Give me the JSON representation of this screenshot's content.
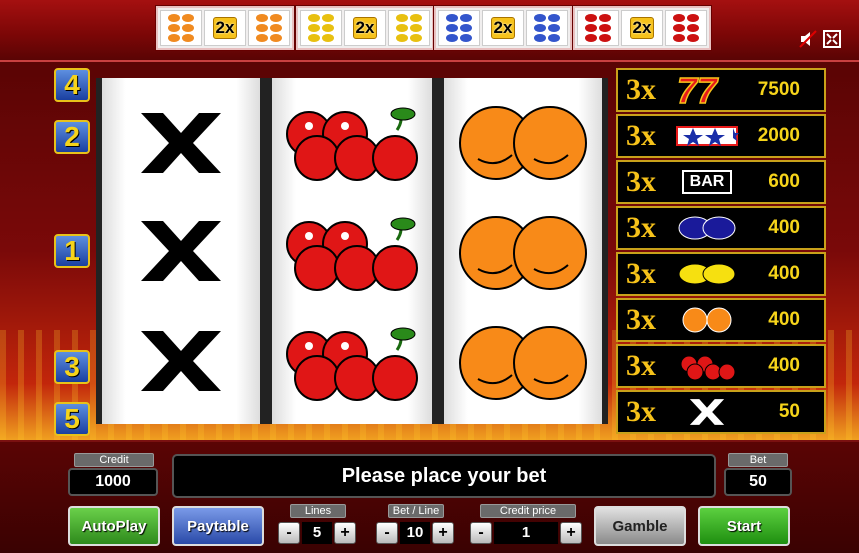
{
  "bonus_multipliers": [
    {
      "label": "2x",
      "fruit_color": "#f08a20"
    },
    {
      "label": "2x",
      "fruit_color": "#e8c010"
    },
    {
      "label": "2x",
      "fruit_color": "#3355cc"
    },
    {
      "label": "2x",
      "fruit_color": "#cc1111"
    }
  ],
  "system_icons": [
    "sound-off-icon",
    "fullscreen-icon"
  ],
  "lines_badges": [
    "4",
    "2",
    "1",
    "3",
    "5"
  ],
  "reels": [
    {
      "symbols": [
        "x",
        "x",
        "x"
      ]
    },
    {
      "symbols": [
        "cherries",
        "cherries",
        "cherries"
      ]
    },
    {
      "symbols": [
        "oranges",
        "oranges",
        "oranges"
      ]
    }
  ],
  "paytable": [
    {
      "count": "3x",
      "symbol": "seven",
      "value": "7500"
    },
    {
      "count": "3x",
      "symbol": "stars",
      "value": "2000"
    },
    {
      "count": "3x",
      "symbol": "bar",
      "value": "600",
      "symbol_text": "BAR"
    },
    {
      "count": "3x",
      "symbol": "plums",
      "value": "400"
    },
    {
      "count": "3x",
      "symbol": "lemons",
      "value": "400"
    },
    {
      "count": "3x",
      "symbol": "oranges",
      "value": "400"
    },
    {
      "count": "3x",
      "symbol": "cherries",
      "value": "400"
    },
    {
      "count": "3x",
      "symbol": "x",
      "value": "50"
    }
  ],
  "credit": {
    "label": "Credit",
    "value": "1000"
  },
  "bet": {
    "label": "Bet",
    "value": "50"
  },
  "message": "Please place your bet",
  "buttons": {
    "autoplay": "AutoPlay",
    "paytable": "Paytable",
    "gamble": "Gamble",
    "start": "Start"
  },
  "lines": {
    "label": "Lines",
    "value": "5",
    "minus": "-",
    "plus": "+"
  },
  "bet_line": {
    "label": "Bet / Line",
    "value": "10",
    "minus": "-",
    "plus": "+"
  },
  "credit_price": {
    "label": "Credit price",
    "value": "1",
    "minus": "-",
    "plus": "+"
  },
  "colors": {
    "gold": "#f6c21a",
    "autoplay": "#2e8a1c",
    "paytable": "#2a4aa8",
    "gamble": "#9a9a9a",
    "start": "#1f8f10"
  }
}
